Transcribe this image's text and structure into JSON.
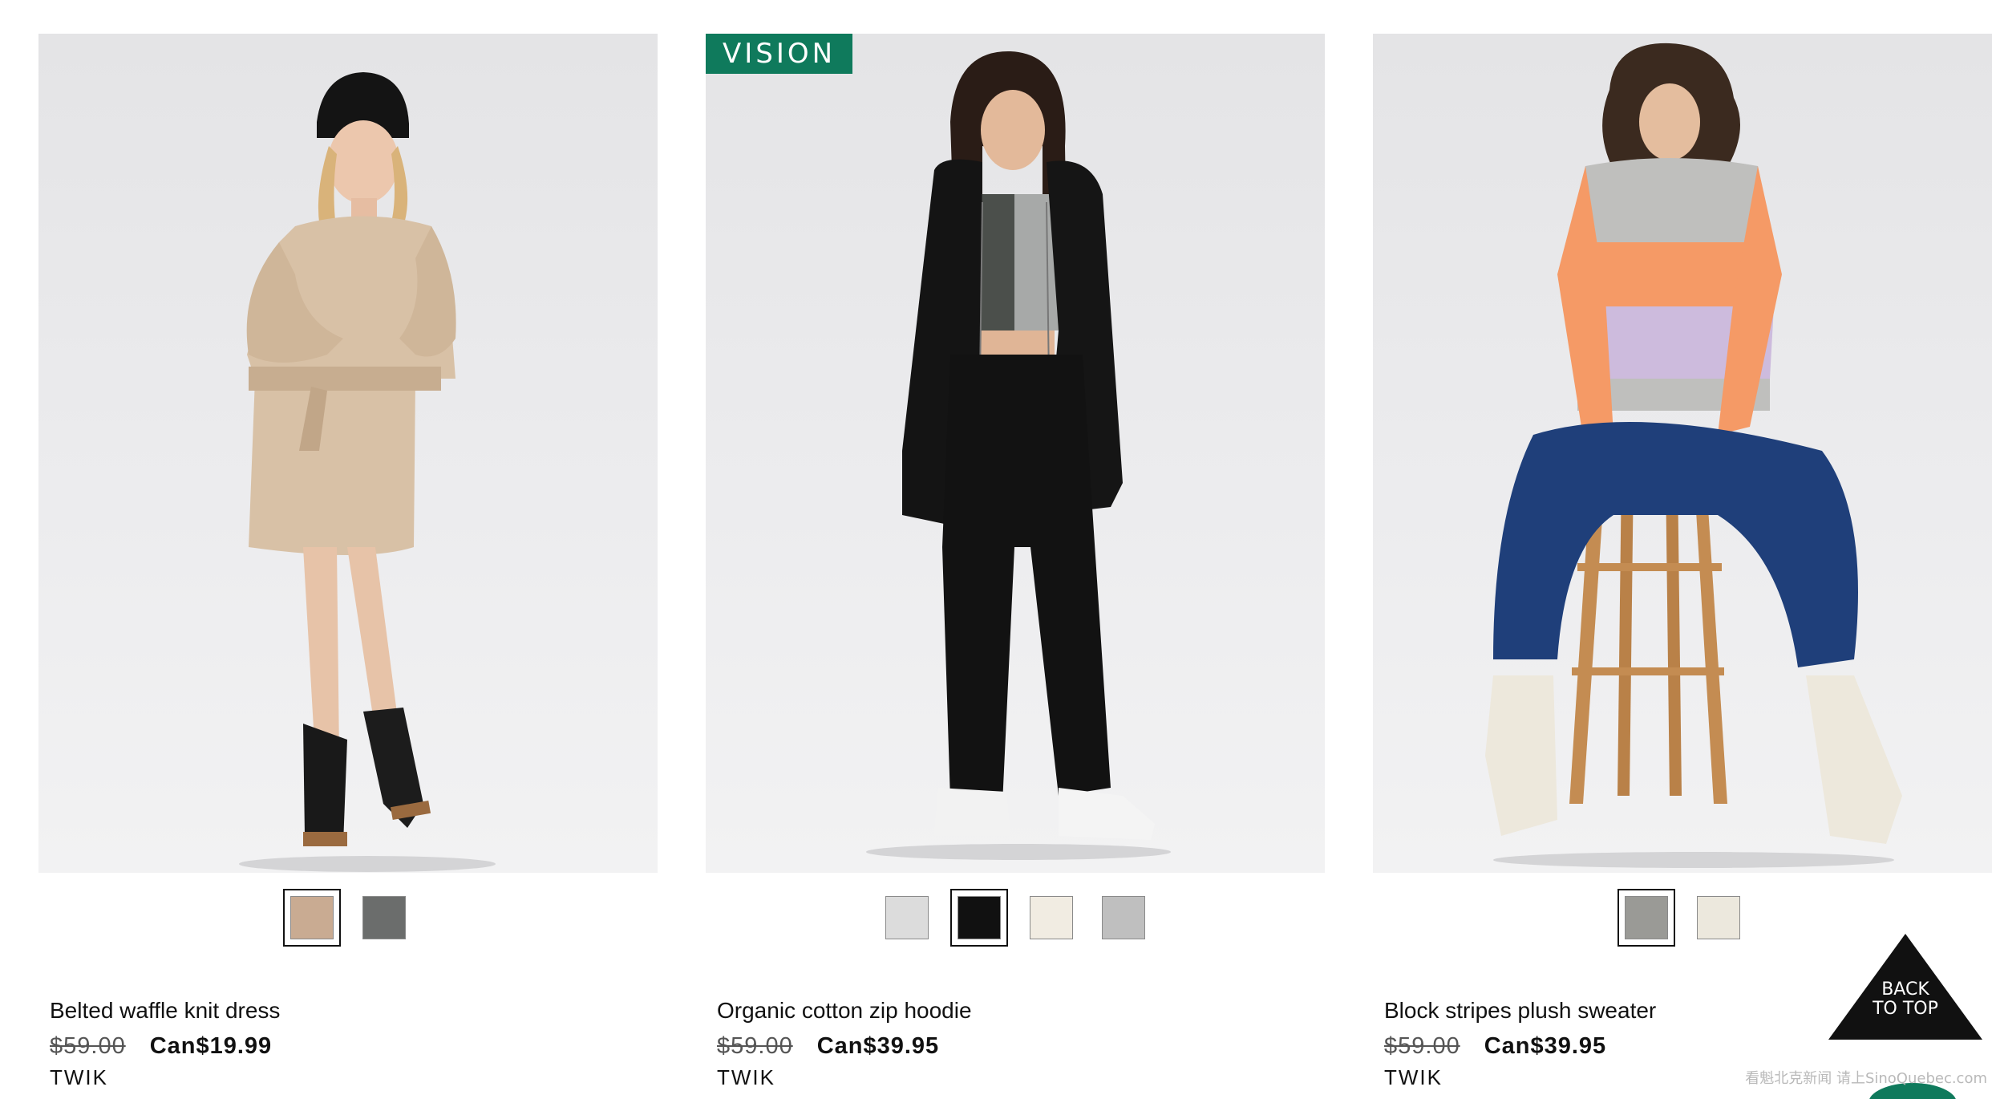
{
  "products": [
    {
      "name": "Belted waffle knit dress",
      "old_price": "$59.00",
      "new_price": "Can$19.99",
      "brand": "TWIK",
      "badge": "",
      "swatches": [
        {
          "color": "#c9ab92",
          "selected": true
        },
        {
          "color": "#6b6d6c",
          "selected": false
        }
      ]
    },
    {
      "name": "Organic cotton zip hoodie",
      "old_price": "$59.00",
      "new_price": "Can$39.95",
      "brand": "TWIK",
      "badge": "VISION",
      "swatches": [
        {
          "color": "#dcdcdc",
          "selected": false
        },
        {
          "color": "#111111",
          "selected": true
        },
        {
          "color": "#f1ece2",
          "selected": false
        },
        {
          "color": "#bfbfbf",
          "selected": false
        }
      ]
    },
    {
      "name": "Block stripes plush sweater",
      "old_price": "$59.00",
      "new_price": "Can$39.95",
      "brand": "TWIK",
      "badge": "",
      "swatches": [
        {
          "color": "#9a9a96",
          "selected": true
        },
        {
          "color": "#ece8dd",
          "selected": false
        }
      ]
    }
  ],
  "back_to_top": {
    "line1": "BACK",
    "line2": "TO TOP"
  },
  "watermark": "看魁北克新闻 请上SinoQuebec.com",
  "colors": {
    "badge_green": "#0f7a5c",
    "text": "#111111"
  }
}
